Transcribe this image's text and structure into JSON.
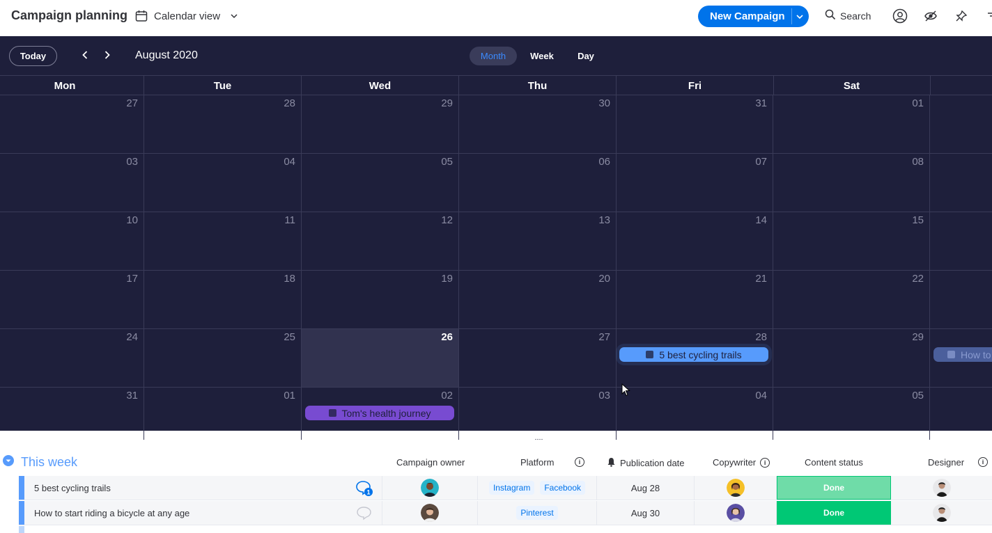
{
  "header": {
    "title": "Campaign planning",
    "view_label": "Calendar view",
    "new_campaign_label": "New Campaign",
    "search_label": "Search"
  },
  "calendar": {
    "today_label": "Today",
    "month_label": "August 2020",
    "modes": [
      "Month",
      "Week",
      "Day"
    ],
    "active_mode": "Month",
    "weekdays": [
      "Mon",
      "Tue",
      "Wed",
      "Thu",
      "Fri",
      "Sat",
      ""
    ],
    "weeks": [
      [
        "27",
        "28",
        "29",
        "30",
        "31",
        "01",
        ""
      ],
      [
        "03",
        "04",
        "05",
        "06",
        "07",
        "08",
        ""
      ],
      [
        "10",
        "11",
        "12",
        "13",
        "14",
        "15",
        ""
      ],
      [
        "17",
        "18",
        "19",
        "20",
        "21",
        "22",
        ""
      ],
      [
        "24",
        "25",
        "26",
        "27",
        "28",
        "29",
        ""
      ],
      [
        "31",
        "01",
        "02",
        "03",
        "04",
        "05",
        ""
      ]
    ],
    "today_date": "26",
    "events": {
      "cycling": "5 best cycling trails",
      "health": "Tom's health journey",
      "howto": "How to"
    }
  },
  "board": {
    "group_title": "This week",
    "columns": {
      "owner": "Campaign owner",
      "platform": "Platform",
      "publication": "Publication date",
      "copywriter": "Copywriter",
      "status": "Content status",
      "designer": "Designer"
    },
    "rows": [
      {
        "name": "5 best cycling trails",
        "platforms": [
          "Instagram",
          "Facebook"
        ],
        "date": "Aug 28",
        "status": "Done",
        "comments": "1"
      },
      {
        "name": "How to start riding a bicycle at any age",
        "platforms": [
          "Pinterest"
        ],
        "date": "Aug 30",
        "status": "Done",
        "comments": ""
      }
    ]
  },
  "colors": {
    "calendar_bg": "#1e1f3b",
    "accent_blue": "#0073ea",
    "status_done": "#00c875",
    "status_done_light": "#6fdca8",
    "event_blue": "#579bfc",
    "event_purple": "#784bd1"
  },
  "icons": [
    "calendar-icon",
    "chevron-down-icon",
    "search-icon",
    "user-icon",
    "eye-icon",
    "pin-icon",
    "menu-icon",
    "chevron-left-icon",
    "chevron-right-icon",
    "chat-icon",
    "info-icon",
    "bell-icon"
  ]
}
